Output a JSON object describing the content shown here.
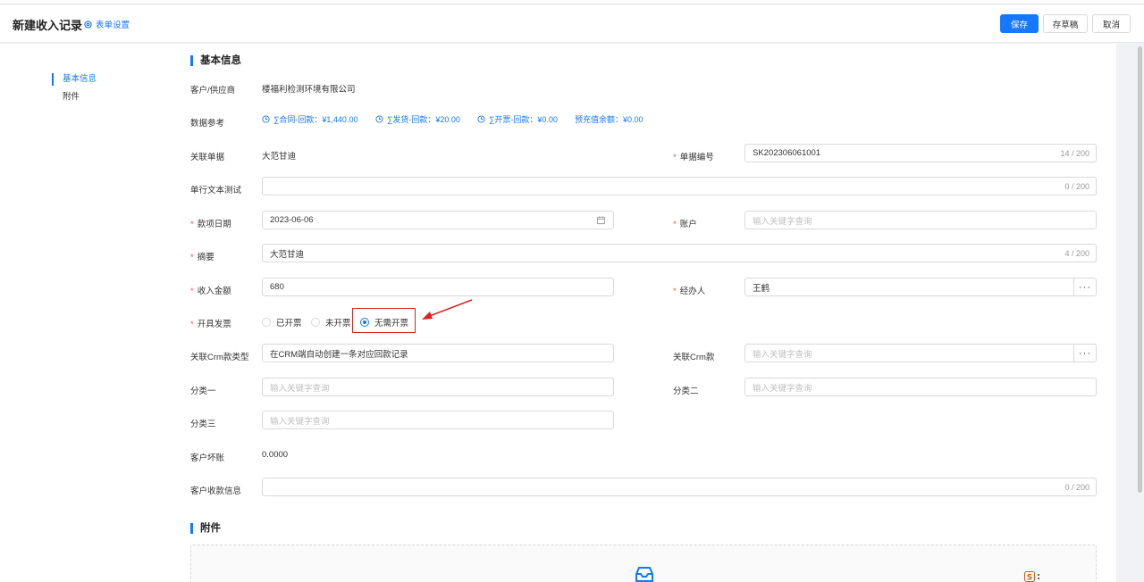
{
  "header": {
    "title": "新建收入记录",
    "form_settings": "表单设置",
    "save": "保存",
    "save_draft": "存草稿",
    "cancel": "取消"
  },
  "nav": {
    "items": [
      {
        "label": "基本信息",
        "active": true
      },
      {
        "label": "附件",
        "active": false
      }
    ]
  },
  "sections": {
    "basic": "基本信息",
    "attachments": "附件"
  },
  "form": {
    "customer_label": "客户/供应商",
    "customer_value": "楼福利检测环境有限公司",
    "data_ref_label": "数据参考",
    "data_refs": [
      "∑合同-回款：¥1,440.00",
      "∑发货-回款：¥20.00",
      "∑开票-回款：¥0.00",
      "预充值余额：¥0.00"
    ],
    "related_doc_label": "关联单据",
    "related_doc_value": "大范甘迪",
    "doc_no_label": "单据编号",
    "doc_no_value": "SK202306061001",
    "doc_no_count": "14 / 200",
    "single_text_label": "单行文本测试",
    "single_text_count": "0 / 200",
    "date_label": "款项日期",
    "date_value": "2023-06-06",
    "account_label": "账户",
    "account_placeholder": "输入关键字查询",
    "summary_label": "摘要",
    "summary_value": "大范甘迪",
    "summary_count": "4 / 200",
    "amount_label": "收入金额",
    "amount_value": "680",
    "handler_label": "经办人",
    "handler_value": "王鹤",
    "invoice_label": "开具发票",
    "invoice_options": [
      "已开票",
      "未开票",
      "无需开票"
    ],
    "invoice_selected": "无需开票",
    "crm_type_label": "关联Crm款类型",
    "crm_type_value": "在CRM端自动创建一条对应回款记录",
    "crm_label": "关联Crm款",
    "crm_placeholder": "输入关键字查询",
    "cat1_label": "分类一",
    "cat1_placeholder": "输入关键字查询",
    "cat2_label": "分类二",
    "cat2_placeholder": "输入关键字查询",
    "cat3_label": "分类三",
    "cat3_placeholder": "输入关键字查询",
    "bad_debt_label": "客户坏账",
    "bad_debt_value": "0.0000",
    "payment_info_label": "客户收款信息",
    "payment_info_count": "0 / 200"
  }
}
